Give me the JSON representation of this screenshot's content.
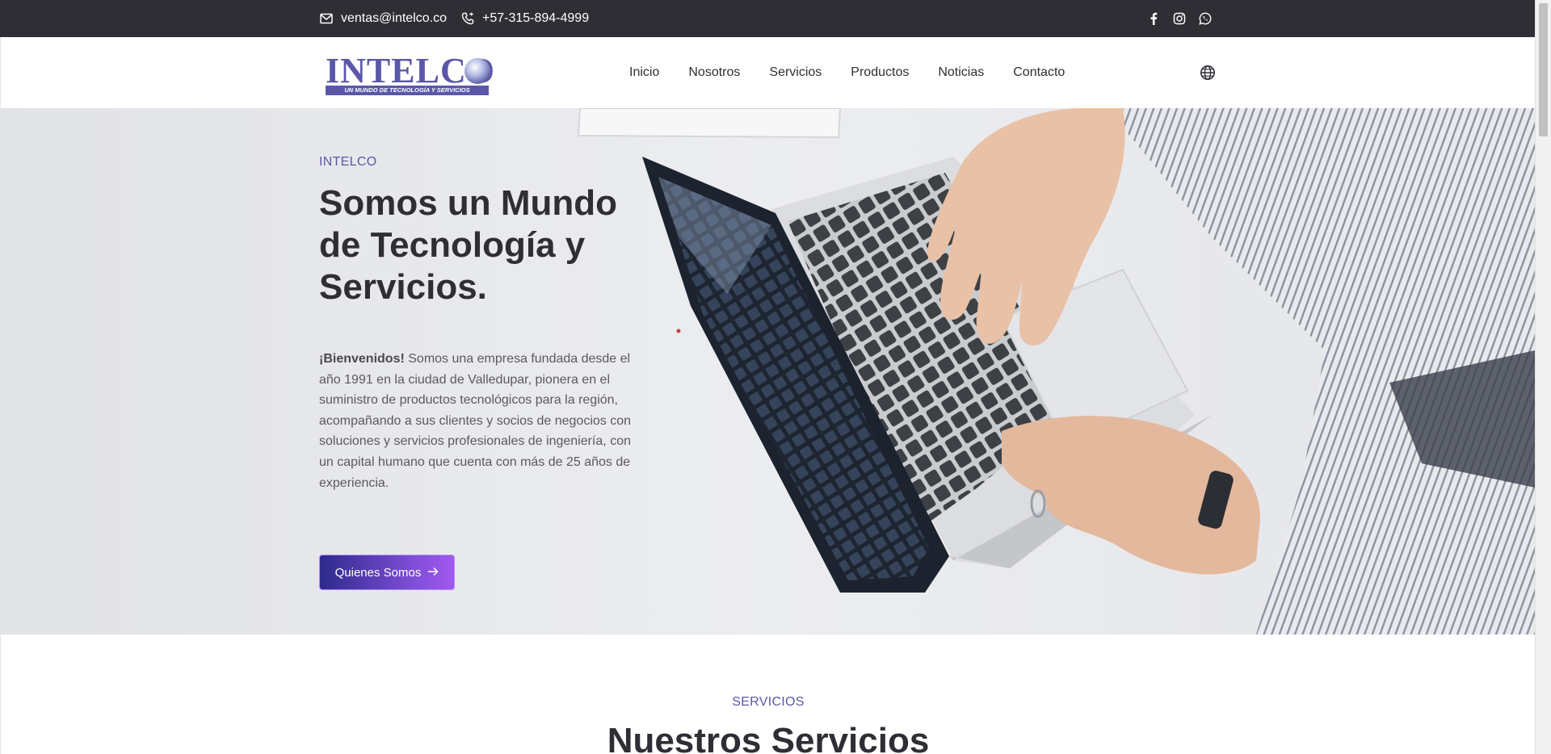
{
  "topbar": {
    "email": "ventas@intelco.co",
    "phone": "+57-315-894-4999",
    "social": [
      {
        "icon": "facebook-icon"
      },
      {
        "icon": "instagram-icon"
      },
      {
        "icon": "whatsapp-icon"
      }
    ]
  },
  "header": {
    "logo": {
      "word": "INTELCO",
      "tagline": "UN MUNDO DE TECNOLOGÍA Y SERVICIOS"
    },
    "nav": [
      "Inicio",
      "Nosotros",
      "Servicios",
      "Productos",
      "Noticias",
      "Contacto"
    ],
    "language_icon": "globe-icon"
  },
  "hero": {
    "eyebrow": "INTELCO",
    "title": "Somos un Mundo de Tecnología y Servicios.",
    "intro_bold": "¡Bienvenidos!",
    "intro_text": " Somos una empresa fundada desde el año 1991 en la ciudad de Valledupar, pionera en el suministro de productos tecnológicos para la región, acompañando a sus clientes y socios de negocios con soluciones y servicios profesionales de ingeniería, con un capital humano que cuenta con más de 25 años de experiencia.",
    "cta_label": "Quienes Somos"
  },
  "services": {
    "eyebrow": "SERVICIOS",
    "title": "Nuestros Servicios"
  },
  "colors": {
    "topbar_bg": "#2f2e35",
    "brand": "#5b57a8",
    "cta_start": "#2e2a8c",
    "cta_end": "#a259ef"
  }
}
